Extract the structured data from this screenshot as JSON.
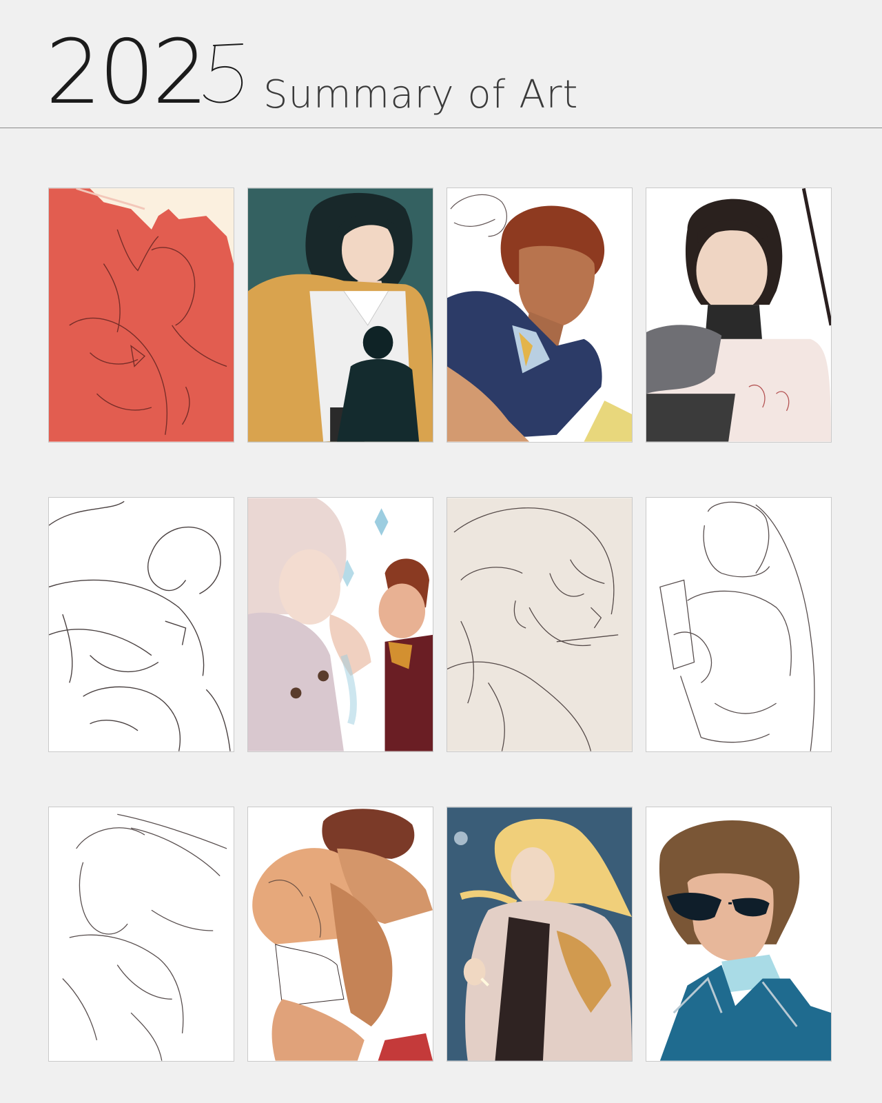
{
  "header": {
    "year_prefix": "202",
    "year_last_digit": "5",
    "subtitle": "Summary of Art"
  },
  "artworks": [
    {
      "name": "artwork-couple-red-sketch",
      "style": "monochrome red sketch",
      "bg": "#e25d50"
    },
    {
      "name": "artwork-woman-yellow-cardigan",
      "style": "painted",
      "bg": "#2f5a5c"
    },
    {
      "name": "artwork-redhead-man-suit",
      "style": "painted",
      "bg": "#ffffff"
    },
    {
      "name": "artwork-dark-hair-armor",
      "style": "painted",
      "bg": "#ffffff"
    },
    {
      "name": "artwork-line-sketch-1",
      "style": "line sketch",
      "bg": "#ffffff"
    },
    {
      "name": "artwork-couple-pastel",
      "style": "painted",
      "bg": "#ffffff"
    },
    {
      "name": "artwork-glasses-sketch",
      "style": "line sketch",
      "bg": "#ede6de"
    },
    {
      "name": "artwork-girl-book-sketch",
      "style": "line sketch",
      "bg": "#ffffff"
    },
    {
      "name": "artwork-line-sketch-2",
      "style": "line sketch",
      "bg": "#ffffff"
    },
    {
      "name": "artwork-couple-embrace-painted",
      "style": "painted",
      "bg": "#ffffff"
    },
    {
      "name": "artwork-blonde-cloak",
      "style": "painted",
      "bg": "#3a5d78"
    },
    {
      "name": "artwork-man-sunglasses-blue-coat",
      "style": "painted",
      "bg": "#ffffff"
    }
  ],
  "colors": {
    "page_bg": "#f0f0f0",
    "ink": "#2a1f1f",
    "divider": "#8a8a8a"
  }
}
